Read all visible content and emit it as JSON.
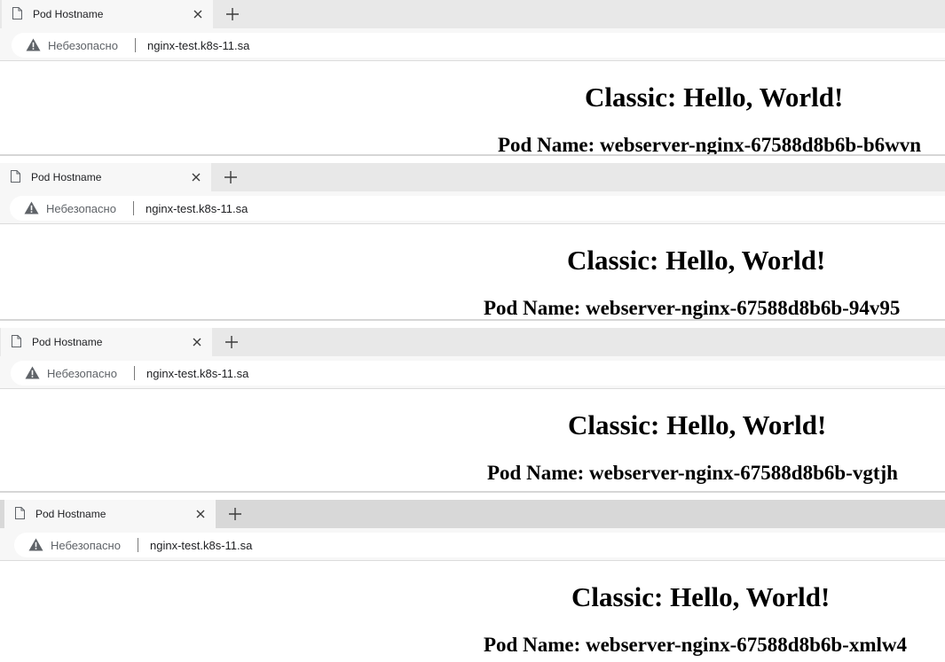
{
  "windows": [
    {
      "tab_title": "Pod Hostname",
      "security_label": "Небезопасно",
      "url": "nginx-test.k8s-11.sa",
      "heading": "Classic: Hello, World!",
      "pod_name": "Pod Name: webserver-nginx-67588d8b6b-b6wvn"
    },
    {
      "tab_title": "Pod Hostname",
      "security_label": "Небезопасно",
      "url": "nginx-test.k8s-11.sa",
      "heading": "Classic: Hello, World!",
      "pod_name": "Pod Name: webserver-nginx-67588d8b6b-94v95"
    },
    {
      "tab_title": "Pod Hostname",
      "security_label": "Небезопасно",
      "url": "nginx-test.k8s-11.sa",
      "heading": "Classic: Hello, World!",
      "pod_name": "Pod Name: webserver-nginx-67588d8b6b-vgtjh"
    },
    {
      "tab_title": "Pod Hostname",
      "security_label": "Небезопасно",
      "url": "nginx-test.k8s-11.sa",
      "heading": "Classic: Hello, World!",
      "pod_name": "Pod Name: webserver-nginx-67588d8b6b-xmlw4"
    }
  ],
  "icons": {
    "page": "page-icon",
    "close": "close-icon",
    "new_tab": "plus-icon",
    "warning": "warning-icon"
  },
  "colors": {
    "tabstrip": "#e8e8e8",
    "active_tab": "#f7f7f7",
    "warning_icon": "#5f6368",
    "text": "#000000"
  }
}
